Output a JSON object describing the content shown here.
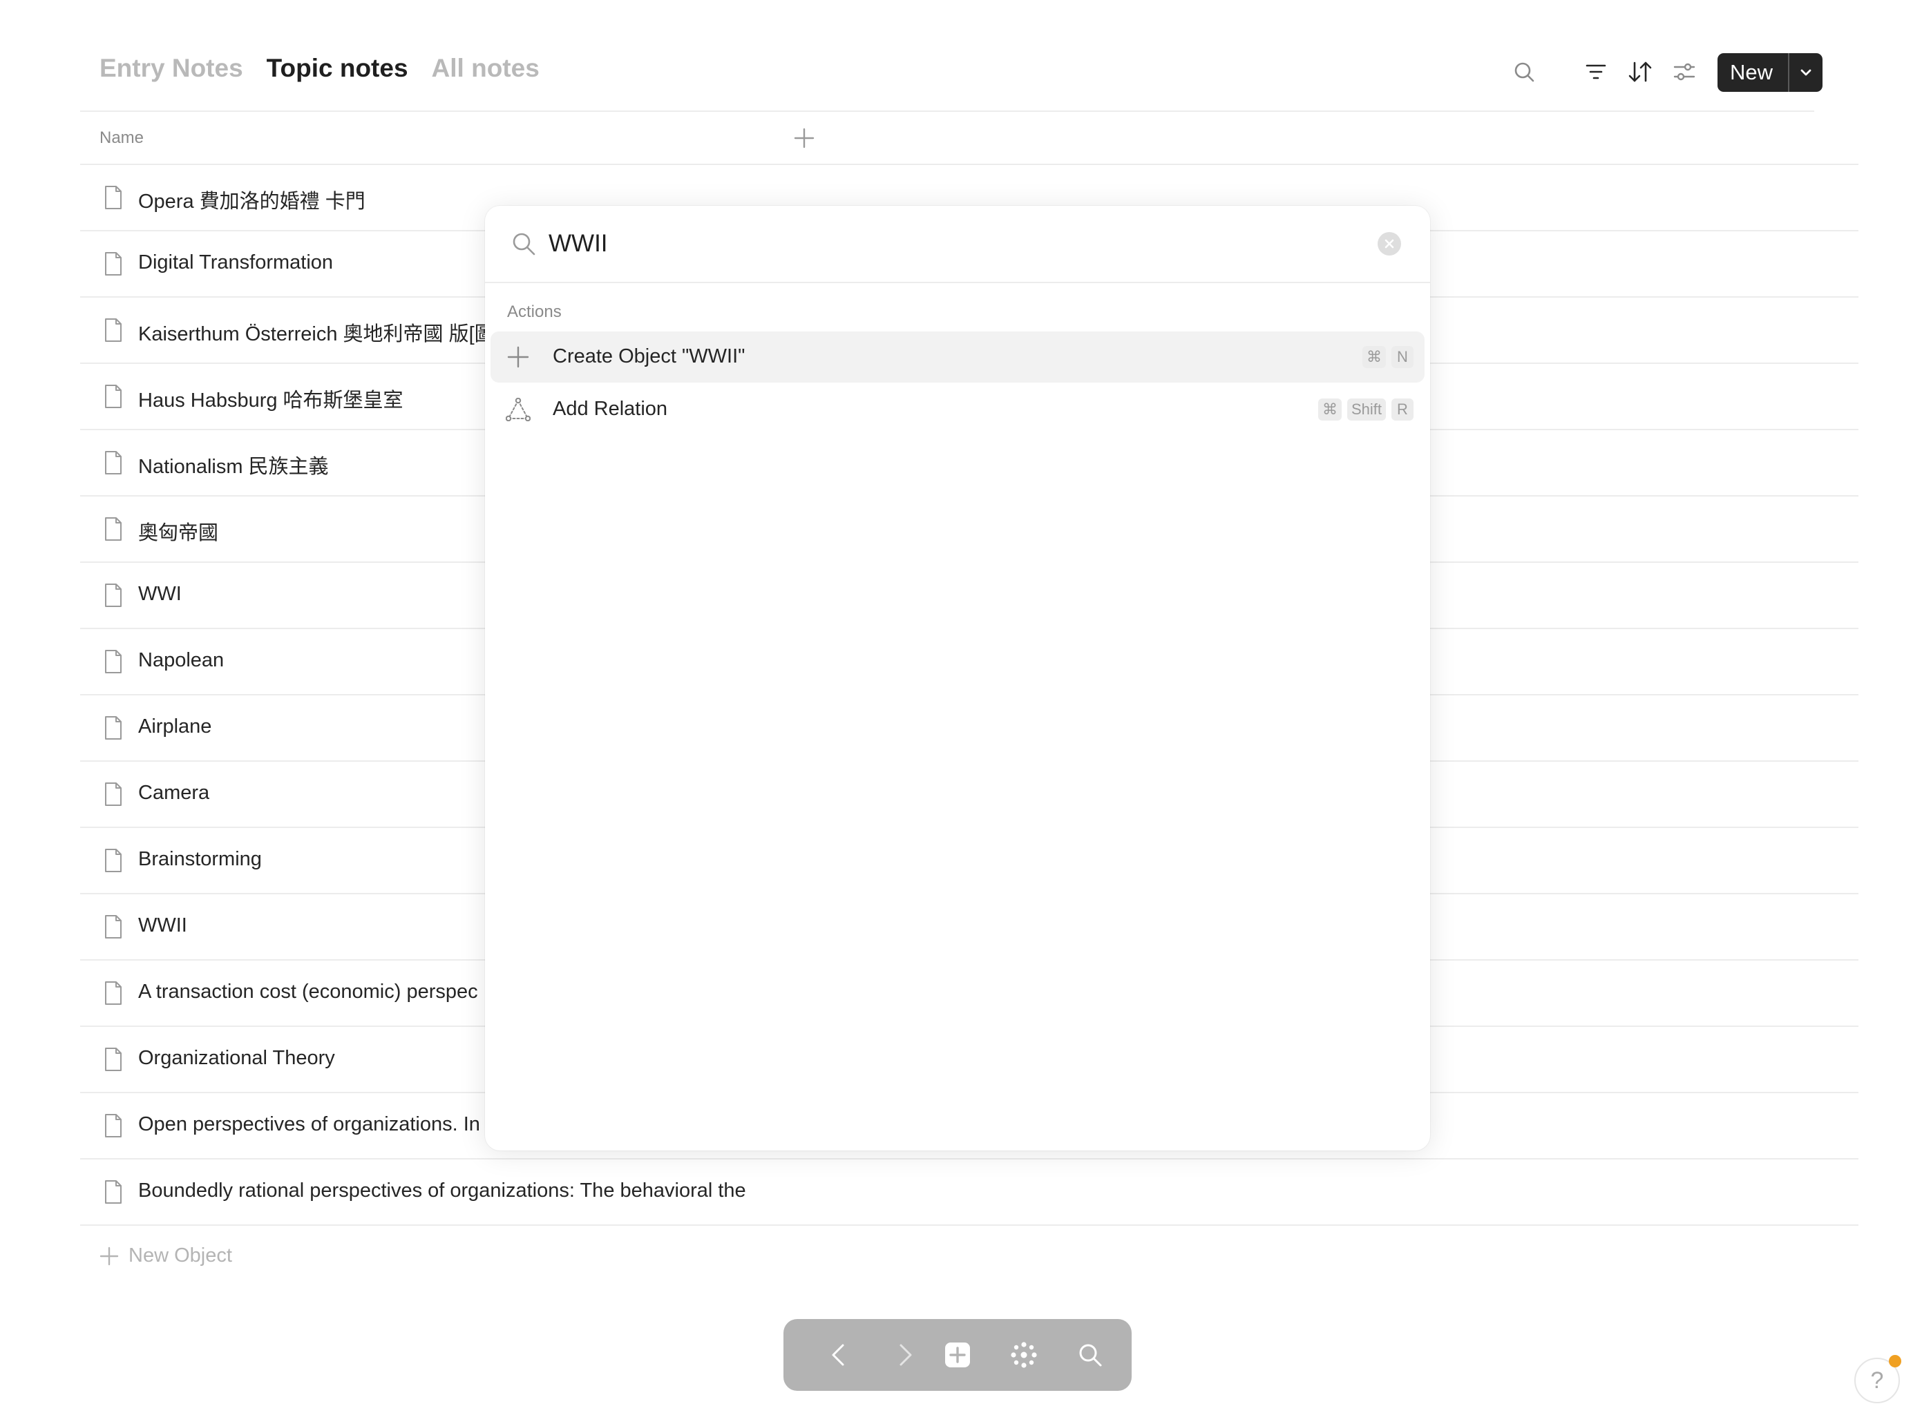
{
  "tabs": [
    {
      "label": "Entry Notes"
    },
    {
      "label": "Topic notes"
    },
    {
      "label": "All notes"
    }
  ],
  "toolbar": {
    "search_icon": "search-icon",
    "filter_icon": "filter-icon",
    "sort_icon": "sort-icon",
    "settings_icon": "sliders-icon",
    "new_label": "New",
    "dropdown_icon": "chevron-down-icon"
  },
  "table": {
    "column_name": "Name",
    "add_column_icon": "plus-icon",
    "rows": [
      {
        "title": "Opera 費加洛的婚禮 卡門"
      },
      {
        "title": "Digital Transformation"
      },
      {
        "title": "Kaiserthum Österreich 奧地利帝國 版[圖"
      },
      {
        "title": "Haus Habsburg 哈布斯堡皇室"
      },
      {
        "title": "Nationalism 民族主義"
      },
      {
        "title": "奧匈帝國"
      },
      {
        "title": "WWI"
      },
      {
        "title": "Napolean"
      },
      {
        "title": "Airplane"
      },
      {
        "title": "Camera"
      },
      {
        "title": "Brainstorming"
      },
      {
        "title": "WWII"
      },
      {
        "title": "A transaction cost (economic) perspec"
      },
      {
        "title": "Organizational Theory"
      },
      {
        "title": "Open perspectives of organizations. In"
      },
      {
        "title": "Boundedly rational perspectives of organizations: The behavioral the"
      }
    ],
    "new_object_label": "New Object"
  },
  "popup": {
    "query": "WWII",
    "section_label": "Actions",
    "actions": [
      {
        "label": "Create Object \"WWII\"",
        "icon": "plus-icon",
        "keys": [
          "⌘",
          "N"
        ]
      },
      {
        "label": "Add Relation",
        "icon": "relation-icon",
        "keys": [
          "⌘",
          "Shift",
          "R"
        ]
      }
    ]
  },
  "bottom_nav": {
    "icons": [
      "back-arrow-icon",
      "forward-arrow-icon",
      "add-square-icon",
      "graph-icon",
      "search-icon"
    ]
  },
  "help": {
    "label": "?"
  },
  "colors": {
    "text": "#252525",
    "muted": "#b9b9b9",
    "button_dark": "#252525",
    "nav_bg": "#b3b3b3",
    "notification_dot": "#f0a022",
    "divider": "#ececec"
  }
}
